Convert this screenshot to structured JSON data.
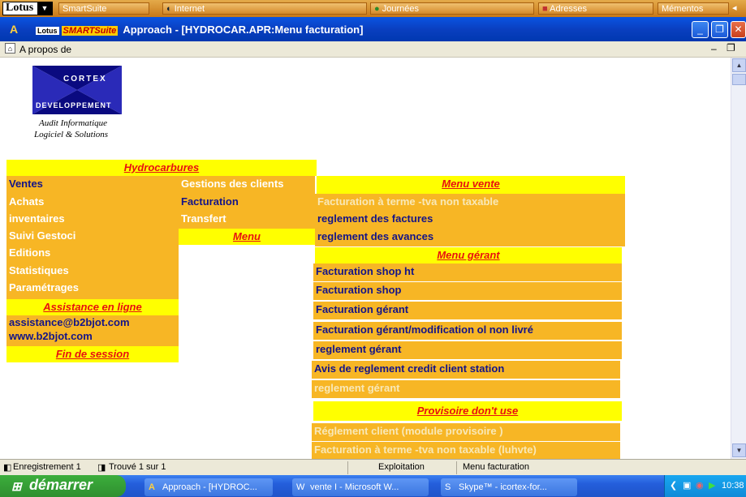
{
  "smartsuite_bar": {
    "logo": "Lotus",
    "items": [
      "SmartSuite",
      "Internet",
      "Journées",
      "Adresses",
      "Mémentos"
    ]
  },
  "titlebar": {
    "lotus_badge": "Lotus",
    "suite_badge": "SMARTSuite",
    "title": "Approach - [HYDROCAR.APR:Menu facturation]"
  },
  "menubar": {
    "item": "A propos de"
  },
  "logo": {
    "top": "CORTEX",
    "bottom": "DEVELOPPEMENT",
    "line1": "Audit Informatique",
    "line2": "Logiciel & Solutions"
  },
  "left_panel": {
    "header": "Hydrocarbures",
    "items": [
      "Ventes",
      "Achats",
      "inventaires",
      "Suivi Gestoci",
      "Editions",
      "Statistiques",
      "Paramétrages"
    ],
    "assistance_header": "Assistance en ligne",
    "email": "assistance@b2bjot.com",
    "website": "www.b2bjot.com",
    "logout": "Fin de session"
  },
  "sub_menu": {
    "items": [
      "Gestions des clients",
      "Facturation",
      "Transfert"
    ],
    "label": "Menu"
  },
  "right_panel": {
    "vente_header": "Menu vente",
    "vente_items": [
      "Facturation à terme -tva non taxable",
      "reglement des factures",
      "reglement des avances"
    ],
    "gerant_header": "Menu gérant",
    "gerant_items": [
      "Facturation shop ht",
      "Facturation shop",
      "Facturation gérant",
      "Facturation gérant/modification ol non livré",
      "reglement gérant",
      "Avis de reglement credit client station",
      "reglement gérant"
    ],
    "provisoire_header": "Provisoire don't use",
    "provisoire_items": [
      "Réglement client (module provisoire )",
      "Facturation à terme -tva non taxable (luhvte)"
    ]
  },
  "statusbar": {
    "record": "Enregistrement 1",
    "found": "Trouvé 1 sur 1",
    "mode": "Exploitation",
    "form": "Menu facturation"
  },
  "taskbar": {
    "start": "démarrer",
    "buttons": [
      "Approach - [HYDROC...",
      "vente I - Microsoft W...",
      "Skype™ - icortex-for..."
    ],
    "clock": "10:38"
  }
}
